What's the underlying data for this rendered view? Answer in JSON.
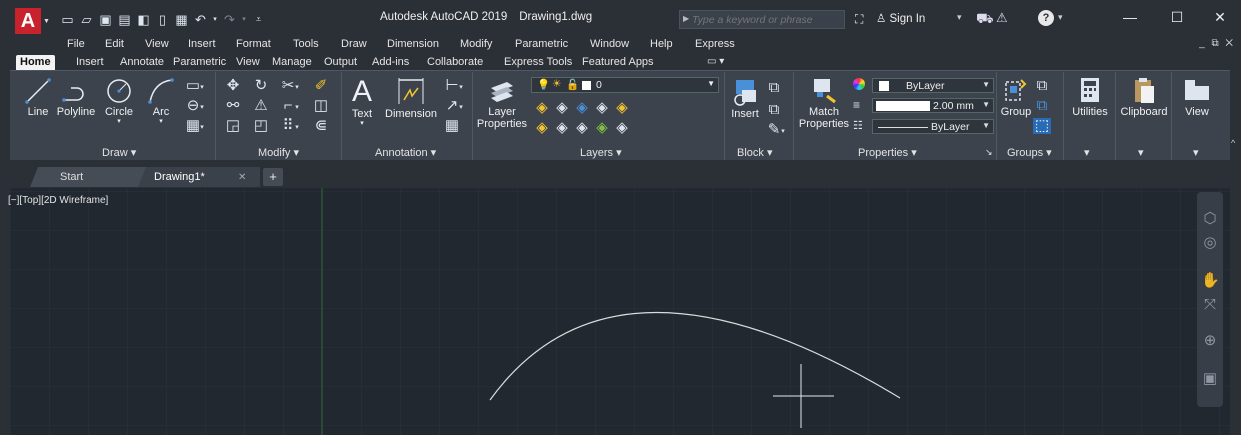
{
  "titlebar": {
    "app_logo": "A",
    "app_name": "Autodesk AutoCAD 2019",
    "doc_name": "Drawing1.dwg",
    "search_placeholder": "Type a keyword or phrase",
    "sign_in": "Sign In",
    "help": "?",
    "minimize": "—",
    "maximize": "☐",
    "close": "✕"
  },
  "menubar": [
    "File",
    "Edit",
    "View",
    "Insert",
    "Format",
    "Tools",
    "Draw",
    "Dimension",
    "Modify",
    "Parametric",
    "Window",
    "Help",
    "Express"
  ],
  "ribbon_tabs": [
    "Home",
    "Insert",
    "Annotate",
    "Parametric",
    "View",
    "Manage",
    "Output",
    "Add-ins",
    "Collaborate",
    "Express Tools",
    "Featured Apps"
  ],
  "active_ribbon_tab": "Home",
  "ribbon": {
    "draw": {
      "line": "Line",
      "polyline": "Polyline",
      "circle": "Circle",
      "arc": "Arc",
      "panel": "Draw ▾"
    },
    "modify": {
      "panel": "Modify ▾"
    },
    "annotation": {
      "text": "Text",
      "dimension": "Dimension",
      "panel": "Annotation ▾"
    },
    "layers": {
      "layer_props_1": "Layer",
      "layer_props_2": "Properties",
      "current_layer": "0",
      "panel": "Layers ▾"
    },
    "block": {
      "insert": "Insert",
      "panel": "Block ▾"
    },
    "properties": {
      "match_1": "Match",
      "match_2": "Properties",
      "color": "ByLayer",
      "lineweight": "2.00 mm",
      "linetype": "ByLayer",
      "panel": "Properties ▾"
    },
    "groups": {
      "group": "Group",
      "panel": "Groups ▾"
    },
    "utilities": {
      "label": "Utilities",
      "panel": "▾"
    },
    "clipboard": {
      "label": "Clipboard",
      "panel": "▾"
    },
    "view": {
      "label": "View",
      "panel": "▾"
    }
  },
  "doc_tabs": {
    "start": "Start",
    "drawing": "Drawing1*",
    "close": "✕",
    "new": "+"
  },
  "viewport": {
    "label": "[−][Top][2D Wireframe]"
  },
  "colors": {
    "background": "#212830",
    "chrome": "#2b2f36",
    "ribbon": "#3c434d",
    "logo": "#c8232c",
    "grid": "#2a323c",
    "axis_y": "#2f6b3a",
    "curve": "#dcdcdc"
  }
}
